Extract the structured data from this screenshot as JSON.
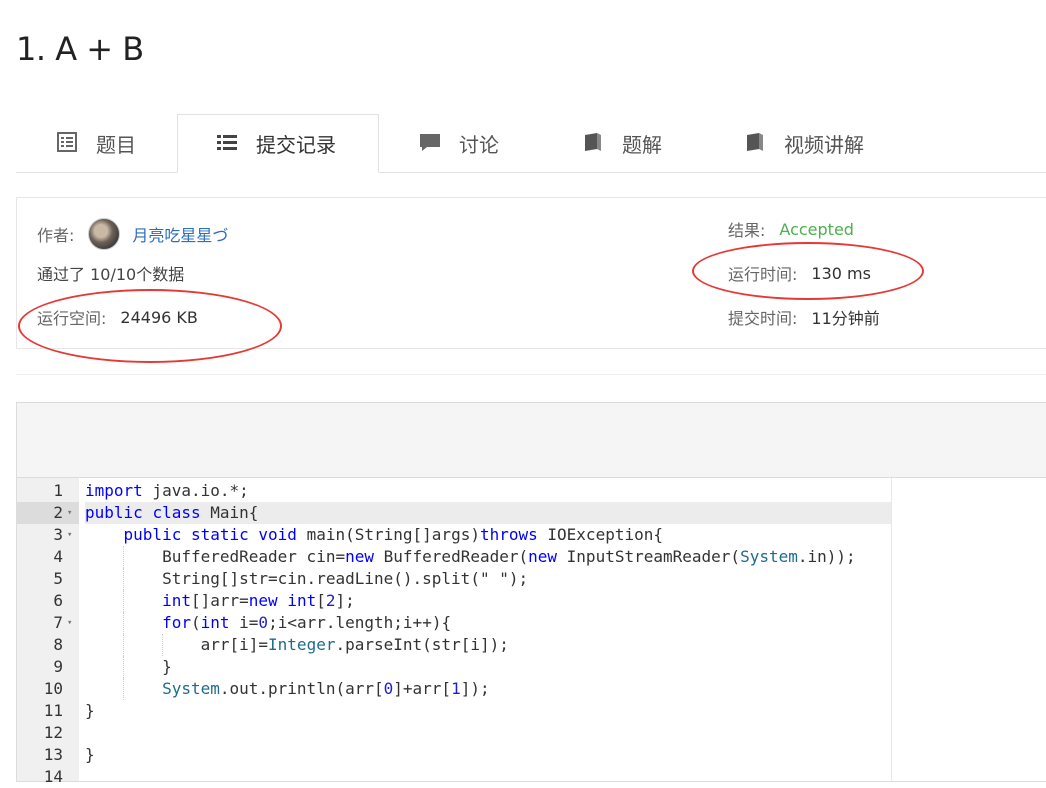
{
  "problem_title": "1. A + B",
  "tabs": [
    {
      "label": "题目",
      "icon": "list-icon"
    },
    {
      "label": "提交记录",
      "icon": "list-bullets-icon"
    },
    {
      "label": "讨论",
      "icon": "comment-icon"
    },
    {
      "label": "题解",
      "icon": "book-icon"
    },
    {
      "label": "视频讲解",
      "icon": "book-icon"
    }
  ],
  "submission": {
    "author_label": "作者:",
    "author_name": "月亮吃星星づ",
    "passed_text": "通过了 10/10个数据",
    "memory_label": "运行空间:",
    "memory_value": "24496 KB",
    "result_label": "结果:",
    "result_value": "Accepted",
    "result_color": "#4caf50",
    "time_label": "运行时间:",
    "time_value": "130 ms",
    "submit_time_label": "提交时间:",
    "submit_time_value": "11分钟前"
  },
  "code": {
    "highlighted_line": 2,
    "lines": [
      "import java.io.*;",
      "public class Main{",
      "    public static void main(String[]args)throws IOException{",
      "        BufferedReader cin=new BufferedReader(new InputStreamReader(System.in));",
      "        String[]str=cin.readLine().split(\" \");",
      "        int[]arr=new int[2];",
      "        for(int i=0;i<arr.length;i++){",
      "            arr[i]=Integer.parseInt(str[i]);",
      "        }",
      "        System.out.println(arr[0]+arr[1]);",
      "}",
      "",
      "}",
      ""
    ],
    "line_numbers": [
      "1",
      "2",
      "3",
      "4",
      "5",
      "6",
      "7",
      "8",
      "9",
      "10",
      "11",
      "12",
      "13",
      "14"
    ],
    "fold_lines": [
      2,
      3,
      7
    ]
  },
  "annotation_color": "#e53935"
}
